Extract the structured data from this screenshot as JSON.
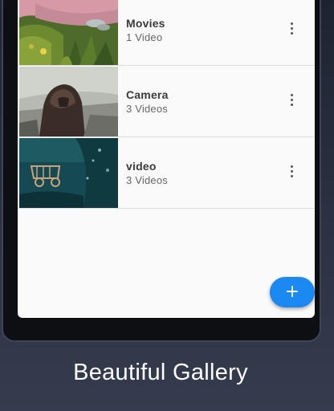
{
  "app_bar": {
    "color": "#f0261c"
  },
  "folders": [
    {
      "title": "Movies",
      "count": "1 Video",
      "thumbnail": "garden-image"
    },
    {
      "title": "Camera",
      "count": "3 Videos",
      "thumbnail": "hooded-figure-image"
    },
    {
      "title": "video",
      "count": "3 Videos",
      "thumbnail": "teal-scene-image"
    }
  ],
  "more_icon": "more-vertical-icon",
  "fab": {
    "icon": "+",
    "color": "#1a8af2"
  },
  "caption": "Beautiful Gallery"
}
